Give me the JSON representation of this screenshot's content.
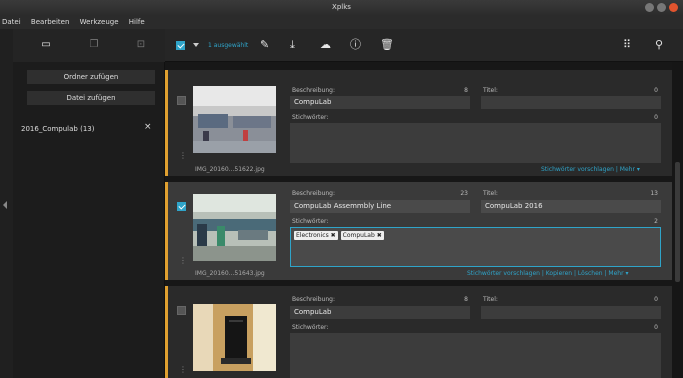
{
  "window": {
    "title": "Xplks"
  },
  "menu": [
    "Datei",
    "Bearbeiten",
    "Werkzeuge",
    "Hilfe"
  ],
  "toolbar": {
    "selected_count": "1 ausgewählt"
  },
  "sidebar": {
    "add_folder": "Ordner zufügen",
    "add_file": "Datei zufügen",
    "collection": "2016_Compulab (13)",
    "remove": "×"
  },
  "labels": {
    "description": "Beschreibung:",
    "title": "Titel:",
    "keywords": "Stichwörter:"
  },
  "cards": [
    {
      "filename": "IMG_20160...51622.jpg",
      "description": "CompuLab",
      "desc_count": "8",
      "title": "",
      "title_count": "0",
      "kw_count": "0",
      "keywords": [],
      "selected": false,
      "links": "Stichwörter vorschlagen | Mehr ▾"
    },
    {
      "filename": "IMG_20160...51643.jpg",
      "description": "CompuLab Assemmbly Line",
      "desc_count": "23",
      "title": "CompuLab 2016",
      "title_count": "13",
      "kw_count": "2",
      "keywords": [
        "Electronics ✖",
        "CompuLab ✖"
      ],
      "selected": true,
      "links": "Stichwörter vorschlagen | Kopieren | Löschen | Mehr ▾"
    },
    {
      "filename": "",
      "description": "CompuLab",
      "desc_count": "8",
      "title": "",
      "title_count": "0",
      "kw_count": "0",
      "keywords": [],
      "selected": false,
      "links": ""
    }
  ],
  "colors": {
    "accent": "#2fa4c9",
    "card_border": "#e0a030"
  }
}
